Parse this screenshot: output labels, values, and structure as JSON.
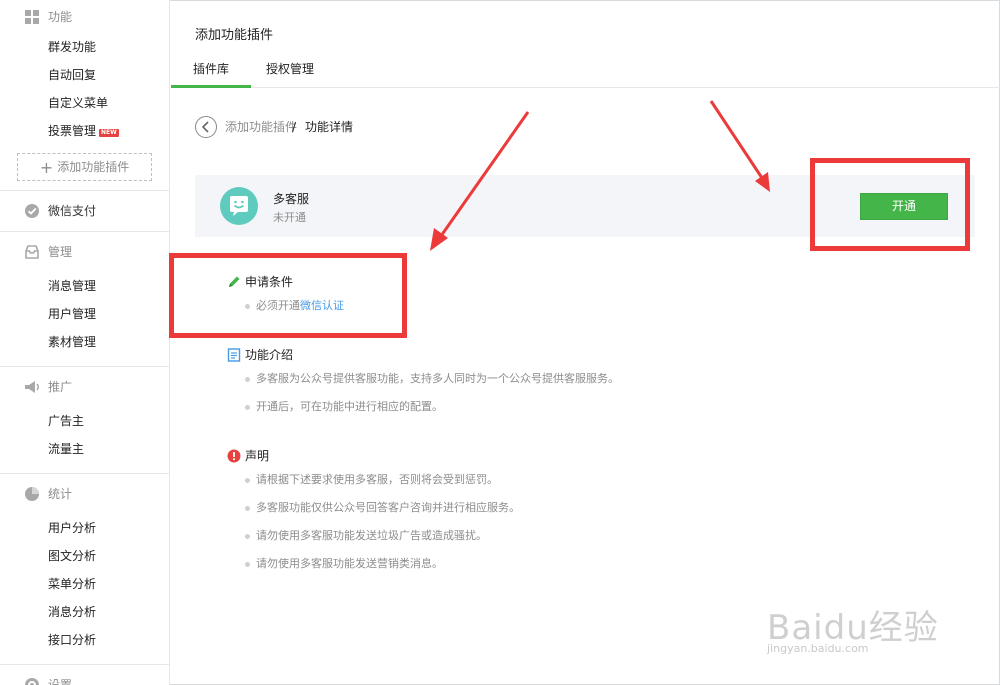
{
  "sidebar": {
    "groups": [
      {
        "title": "功能",
        "icon": "grid-icon",
        "items": [
          {
            "label": "群发功能"
          },
          {
            "label": "自动回复"
          },
          {
            "label": "自定义菜单"
          },
          {
            "label": "投票管理",
            "badge": "NEW"
          }
        ],
        "add_button": "添加功能插件"
      },
      {
        "title": "微信支付",
        "icon": "wechat-pay-icon",
        "items": []
      },
      {
        "title": "管理",
        "icon": "inbox-icon",
        "items": [
          {
            "label": "消息管理"
          },
          {
            "label": "用户管理"
          },
          {
            "label": "素材管理"
          }
        ]
      },
      {
        "title": "推广",
        "icon": "megaphone-icon",
        "items": [
          {
            "label": "广告主"
          },
          {
            "label": "流量主"
          }
        ]
      },
      {
        "title": "统计",
        "icon": "pie-chart-icon",
        "items": [
          {
            "label": "用户分析"
          },
          {
            "label": "图文分析"
          },
          {
            "label": "菜单分析"
          },
          {
            "label": "消息分析"
          },
          {
            "label": "接口分析"
          }
        ]
      },
      {
        "title": "设置",
        "icon": "gear-icon",
        "items": []
      }
    ]
  },
  "main": {
    "title": "添加功能插件",
    "tabs": [
      {
        "label": "插件库",
        "active": true
      },
      {
        "label": "授权管理",
        "active": false
      }
    ],
    "breadcrumb": {
      "parent": "添加功能插件",
      "separator": "/",
      "current": "功能详情"
    },
    "plugin": {
      "name": "多客服",
      "status": "未开通",
      "action_label": "开通",
      "avatar_color": "#5fcbbe"
    },
    "sections": [
      {
        "title": "申请条件",
        "icon": "pencil-icon",
        "items": [
          {
            "text": "必须开通",
            "link": "微信认证"
          }
        ]
      },
      {
        "title": "功能介绍",
        "icon": "document-icon",
        "items": [
          {
            "text": "多客服为公众号提供客服功能，支持多人同时为一个公众号提供客服服务。"
          },
          {
            "text": "开通后，可在功能中进行相应的配置。"
          }
        ]
      },
      {
        "title": "声明",
        "icon": "warning-icon",
        "items": [
          {
            "text": "请根据下述要求使用多客服，否则将会受到惩罚。"
          },
          {
            "text": "多客服功能仅供公众号回答客户咨询并进行相应服务。"
          },
          {
            "text": "请勿使用多客服功能发送垃圾广告或造成骚扰。"
          },
          {
            "text": "请勿使用多客服功能发送营销类消息。"
          }
        ]
      }
    ]
  },
  "watermark": {
    "brand": "Baidu经验",
    "url": "jingyan.baidu.com"
  },
  "colors": {
    "accent": "#44b549",
    "link": "#459ae9",
    "annotation": "#ec3a3b"
  }
}
